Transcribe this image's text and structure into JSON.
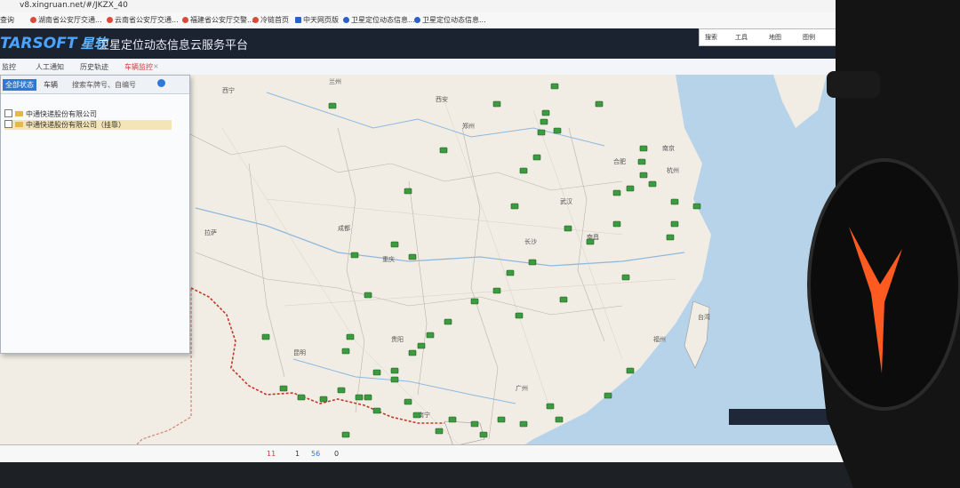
{
  "browser": {
    "url": "v8.xingruan.net/#/JKZX_40",
    "bookmarks": [
      "查询",
      "湖南省公安厅交通...",
      "云南省公安厅交通...",
      "福建省公安厅交警...",
      "冷链首页",
      "中天网页版",
      "卫星定位动态信息...",
      "卫星定位动态信息..."
    ]
  },
  "app": {
    "logo_en": "TARSOFT",
    "logo_cn": "星软",
    "title": "卫星定位动态信息云服务平台"
  },
  "tabs": [
    {
      "label": "监控",
      "active": false
    },
    {
      "label": "人工通知",
      "active": false
    },
    {
      "label": "历史轨迹",
      "active": false
    },
    {
      "label": "车辆监控",
      "active": true
    }
  ],
  "panel": {
    "status_btn": "全部状态",
    "vehicle_select": "车辆",
    "search_placeholder": "搜索车牌号、自编号",
    "rows": [
      "中通快递股份有限公司",
      "中通快递股份有限公司（挂靠）"
    ]
  },
  "tools": [
    "搜索",
    "工具",
    "地图",
    "图例"
  ],
  "map": {
    "places": [
      "兰州",
      "西安",
      "成都",
      "重庆",
      "武汉",
      "长沙",
      "南昌",
      "合肥",
      "杭州",
      "南京",
      "福州",
      "广州",
      "南宁",
      "贵阳",
      "昆明",
      "郑州",
      "西宁",
      "拉萨",
      "台湾"
    ]
  },
  "status": {
    "counts": [
      "11",
      "1",
      "56",
      "0"
    ]
  },
  "colors": {
    "appbar": "#1b2330",
    "active_tab": "#d9363e",
    "vehicle": "#3c9a3f",
    "border_line": "#c0392b",
    "sea": "#b6d3ea"
  }
}
